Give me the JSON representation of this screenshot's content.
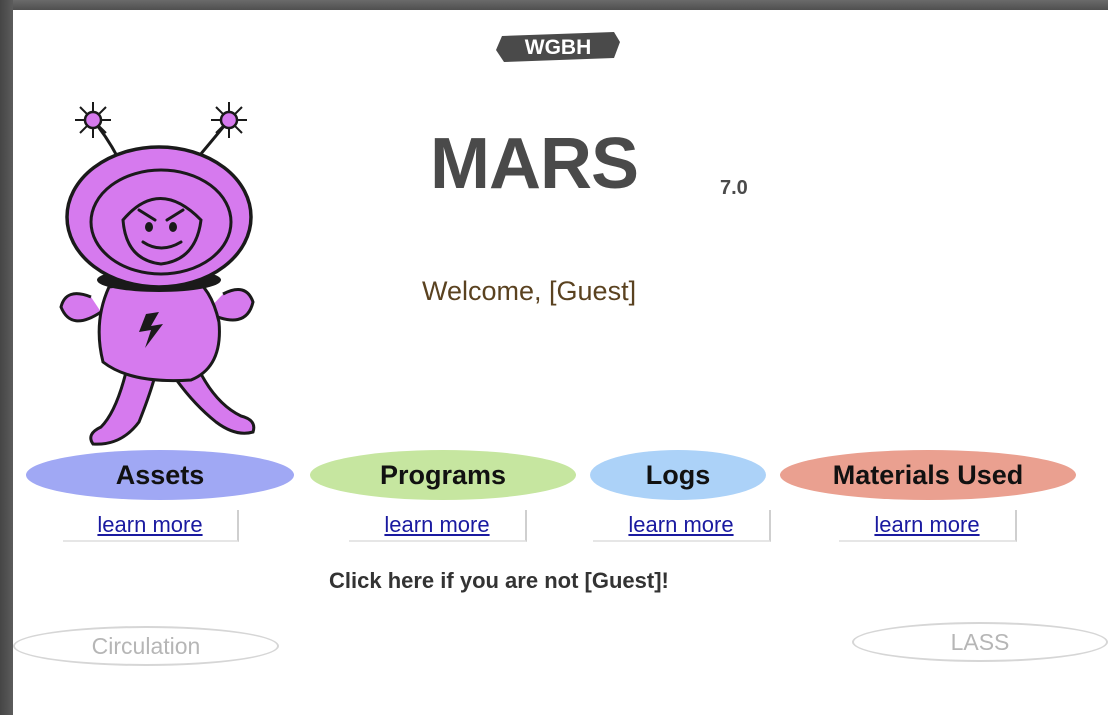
{
  "header": {
    "logo_text": "WGBH",
    "title": "MARS",
    "version": "7.0",
    "welcome": "Welcome, [Guest]"
  },
  "modules": [
    {
      "label": "Assets",
      "color": "#a0a8f4",
      "learn_more": "learn more"
    },
    {
      "label": "Programs",
      "color": "#c6e6a0",
      "learn_more": "learn more"
    },
    {
      "label": "Logs",
      "color": "#acd2f8",
      "learn_more": "learn more"
    },
    {
      "label": "Materials Used",
      "color": "#eaa090",
      "learn_more": "learn more"
    }
  ],
  "notice": "Click here if you are not [Guest]!",
  "footer": {
    "left_link": "Circulation",
    "right_link": "LASS"
  },
  "colors": {
    "mascot_body": "#d67aee",
    "mascot_outline": "#1a1a1a"
  }
}
